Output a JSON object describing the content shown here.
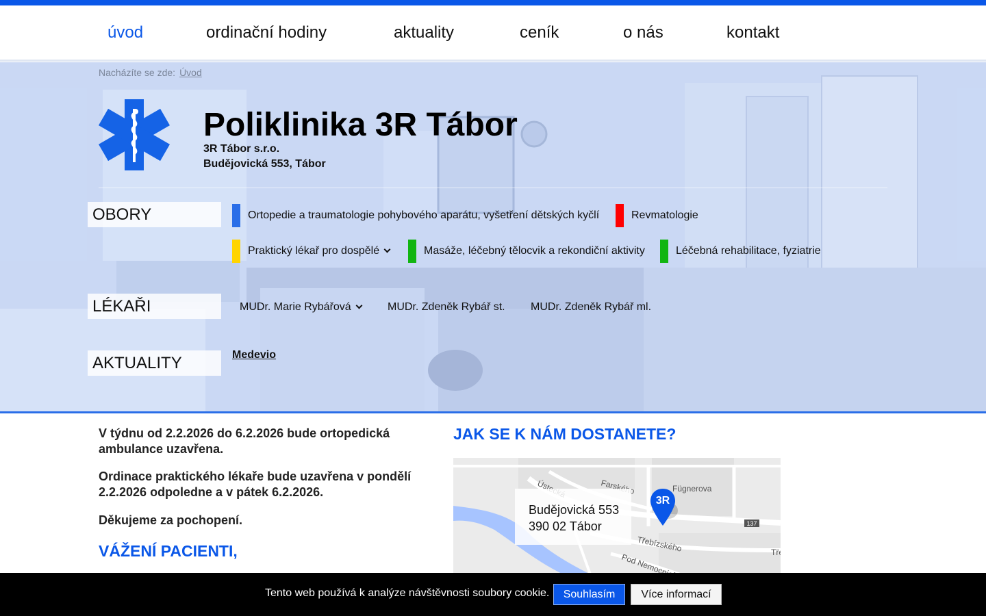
{
  "nav": {
    "items": [
      "úvod",
      "ordinační hodiny",
      "aktuality",
      "ceník",
      "o nás",
      "kontakt"
    ]
  },
  "breadcrumb": {
    "label": "Nacházíte se zde:",
    "current": "Úvod"
  },
  "brand": {
    "title": "Poliklinika 3R Tábor",
    "company": "3R Tábor s.r.o.",
    "address": "Budějovická 553, Tábor"
  },
  "sections": {
    "obory": "OBORY",
    "lekari": "LÉKAŘI",
    "aktuality": "AKTUALITY"
  },
  "specialties": [
    {
      "label": "Ortopedie a traumatologie pohybového aparátu, vyšetření dětských kyčlí",
      "color": "#2a6ee8"
    },
    {
      "label": "Revmatologie",
      "color": "#ff0000"
    },
    {
      "label": "Praktický lékař pro dospělé",
      "color": "#ffd400"
    },
    {
      "label": "Masáže, léčebný tělocvik a rekondiční aktivity",
      "color": "#11b511"
    },
    {
      "label": "Léčebná rehabilitace, fyziatrie",
      "color": "#11b511"
    }
  ],
  "doctors": [
    "MUDr. Marie Rybářová",
    "MUDr. Zdeněk Rybář st.",
    "MUDr. Zdeněk Rybář ml."
  ],
  "news_link": "Medevio",
  "content": {
    "p1": "V týdnu od 2.2.2026 do 6.2.2026 bude ortopedická ambulance uzavřena.",
    "p2": "Ordinace praktického lékaře bude uzavřena v pondělí 2.2.2026 odpoledne a v pátek 6.2.2026.",
    "p3": "Děkujeme za pochopení.",
    "h_patients": "VÁŽENÍ PACIENTI,",
    "h_directions": "JAK SE K NÁM DOSTANETE?"
  },
  "map": {
    "marker": "3R",
    "line1": "Budějovická 553",
    "line2": "390 02 Tábor",
    "streets": [
      "Ústecká",
      "Farského",
      "Fügnerova",
      "Třebízského",
      "Pod Nemocnicí",
      "137",
      "Tře"
    ]
  },
  "cookie": {
    "text": "Tento web používá k analýze návštěvnosti soubory cookie.",
    "accept": "Souhlasím",
    "more": "Více informací"
  },
  "colors": {
    "accent": "#0a57e8"
  }
}
